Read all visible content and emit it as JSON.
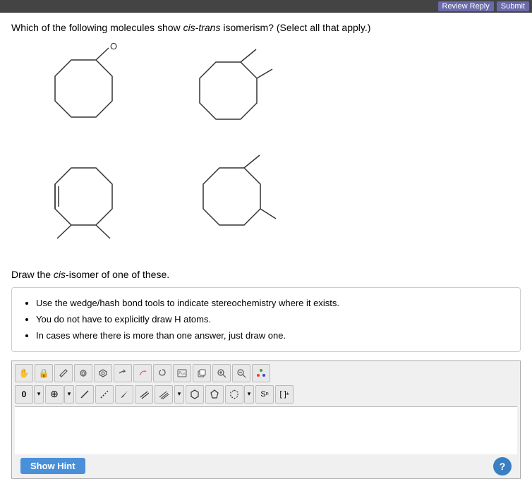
{
  "topBar": {
    "btn1": "Review Reply",
    "btn2": "Submit"
  },
  "question": {
    "text_before": "Which of the following molecules show ",
    "italic": "cis-trans",
    "text_after": " isomerism? (Select all that apply.)"
  },
  "drawInstruction": {
    "text_before": "Draw the ",
    "italic": "cis",
    "text_after": "-isomer of one of these."
  },
  "hintBox": {
    "items": [
      "Use the wedge/hash bond tools to indicate stereochemistry where it exists.",
      "You do not have to explicitly draw H atoms.",
      "In cases where there is more than one answer, just draw one."
    ]
  },
  "toolbar": {
    "row1_tools": [
      "hand",
      "lock",
      "pencil",
      "ring",
      "ring2",
      "arrow1",
      "arrow2",
      "lasso",
      "img",
      "copy",
      "zoom-in",
      "zoom-out",
      "color"
    ],
    "row2_tools": [
      "zero",
      "plus",
      "bond-single",
      "bond-dash",
      "bond-wedge",
      "bond-double",
      "bond-triple",
      "bond-select",
      "hex",
      "penta",
      "ring-open",
      "chain",
      "subscript",
      "bracket"
    ]
  },
  "bottomBar": {
    "showHint": "Show Hint",
    "questionMark": "?"
  }
}
